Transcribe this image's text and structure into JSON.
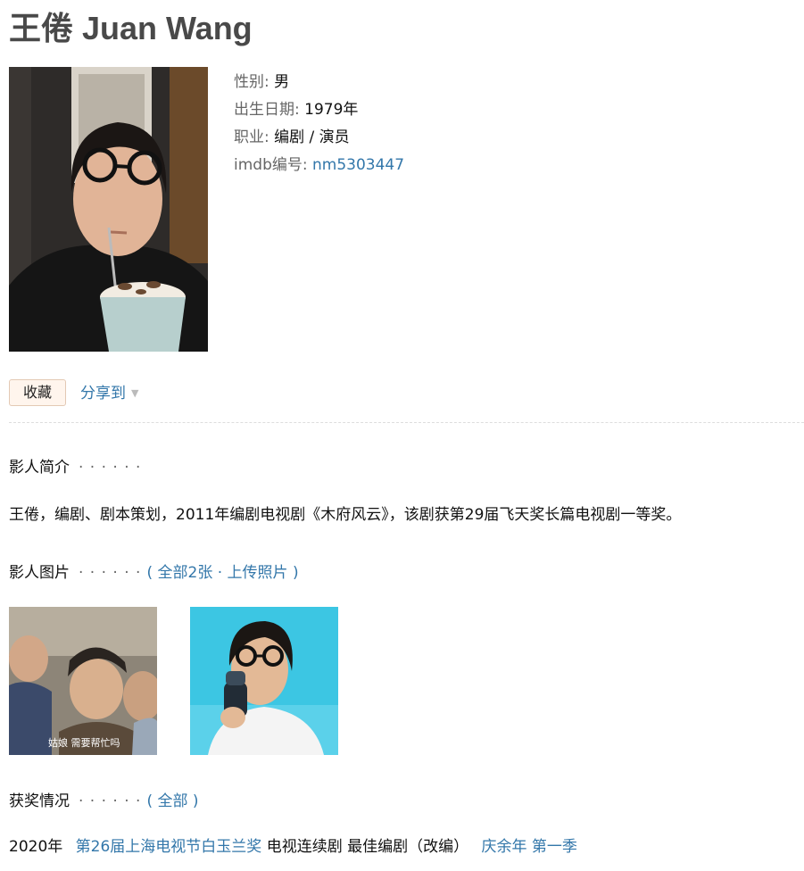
{
  "person": {
    "title": "王倦 Juan Wang"
  },
  "info": {
    "gender_label": "性别",
    "gender_value": "男",
    "birth_label": "出生日期",
    "birth_value": "1979年",
    "job_label": "职业",
    "job_value": "编剧 / 演员",
    "imdb_label": "imdb编号",
    "imdb_value": "nm5303447"
  },
  "actions": {
    "collect_label": "收藏",
    "share_label": "分享到"
  },
  "intro_section": {
    "title": "影人简介",
    "dots": "· · · · · ·",
    "text": "王倦，编剧、剧本策划，2011年编剧电视剧《木府风云》，该剧获第29届飞天奖长篇电视剧一等奖。"
  },
  "photos_section": {
    "title": "影人图片",
    "dots": "· · · · · ·",
    "paren_open": "(",
    "all_link": "全部2张",
    "sep": "·",
    "upload_link": "上传照片",
    "paren_close": ")",
    "photo1_caption": "姑娘 需要帮忙吗"
  },
  "awards_section": {
    "title": "获奖情况",
    "dots": "· · · · · ·",
    "paren_open": "(",
    "all_link": "全部",
    "paren_close": ")"
  },
  "awards": [
    {
      "year": "2020年",
      "festival": "第26届上海电视节白玉兰奖",
      "category": "电视连续剧 最佳编剧（改编）",
      "work": "庆余年 第一季"
    }
  ],
  "colors": {
    "link": "#3377aa",
    "heading": "#494949",
    "label": "#666666",
    "collect_bg": "#fff5ed"
  },
  "icons": {
    "share_dropdown": "caret-down-icon"
  }
}
